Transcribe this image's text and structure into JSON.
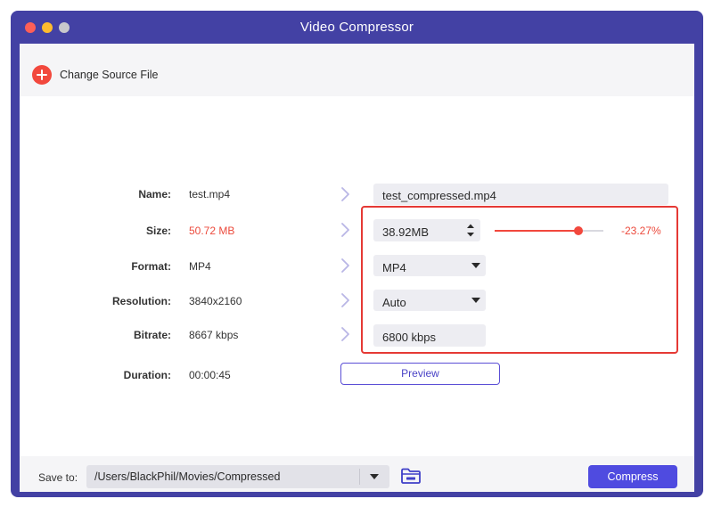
{
  "window": {
    "title": "Video Compressor"
  },
  "toolbar": {
    "change_source_label": "Change Source File"
  },
  "rows": {
    "name": {
      "label": "Name:",
      "source": "test.mp4",
      "target": "test_compressed.mp4"
    },
    "size": {
      "label": "Size:",
      "source": "50.72 MB",
      "target": "38.92MB",
      "change_percent": "-23.27%",
      "slider_fraction": 0.767
    },
    "format": {
      "label": "Format:",
      "source": "MP4",
      "target": "MP4"
    },
    "resolution": {
      "label": "Resolution:",
      "source": "3840x2160",
      "target": "Auto"
    },
    "bitrate": {
      "label": "Bitrate:",
      "source": "8667 kbps",
      "target": "6800 kbps"
    },
    "duration": {
      "label": "Duration:",
      "source": "00:00:45"
    }
  },
  "preview_label": "Preview",
  "footer": {
    "save_to_label": "Save to:",
    "save_path": "/Users/BlackPhil/Movies/Compressed",
    "compress_label": "Compress"
  },
  "colors": {
    "window_frame": "#4341a4",
    "accent": "#4f4be0",
    "alert_red": "#ec4a3c",
    "highlight_border": "#e53935"
  },
  "icons": {
    "add": "plus-circle-icon",
    "arrow": "chevron-right-icon",
    "folder": "folder-icon",
    "stepper": "up-down-stepper-icon",
    "dropdown": "caret-down-icon"
  }
}
